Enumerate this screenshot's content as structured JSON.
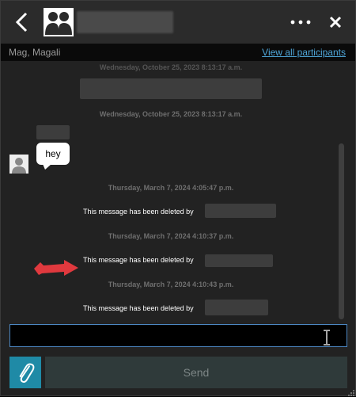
{
  "header": {
    "back_icon": "chevron-left-icon",
    "group_icon": "group-icon",
    "more_icon": "ellipsis-icon",
    "close_icon": "close-icon"
  },
  "participants": {
    "names": "Mag, Magali",
    "view_all": "View all participants"
  },
  "messages": {
    "timestamp_0": "Wednesday, October 25, 2023 8:13:17 a.m.",
    "timestamp_1": "Wednesday, October 25, 2023 8:13:17 a.m.",
    "hey": "hey",
    "timestamp_2": "Thursday, March 7, 2024 4:05:47 p.m.",
    "deleted_1": "This message has been deleted by",
    "timestamp_3": "Thursday, March 7, 2024 4:10:37 p.m.",
    "deleted_2": "This message has been deleted by",
    "timestamp_4": "Thursday, March 7, 2024 4:10:43 p.m.",
    "deleted_3": "This message has been deleted by"
  },
  "composer": {
    "send_label": "Send",
    "attach_icon": "paperclip-icon"
  },
  "colors": {
    "accent": "#1f8aa6",
    "link": "#4fa6d8",
    "arrow": "#e0393e"
  }
}
